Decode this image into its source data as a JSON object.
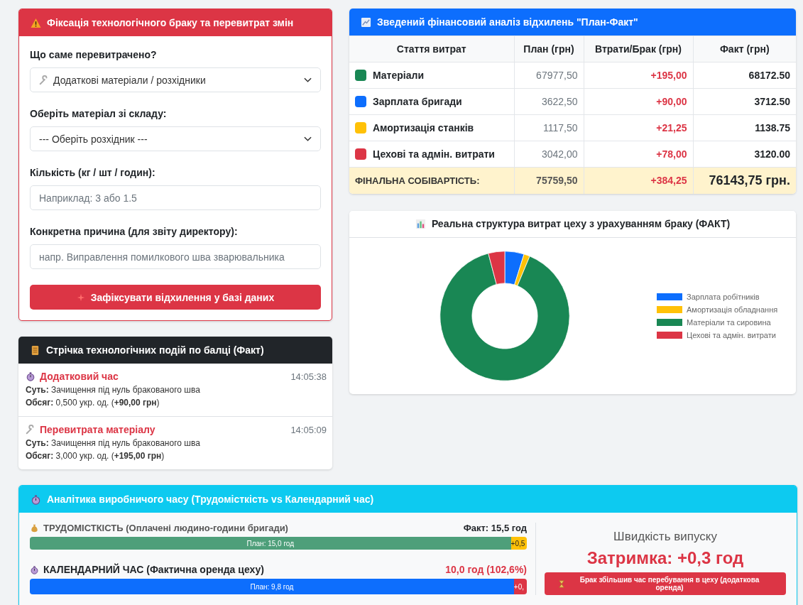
{
  "deviation_form": {
    "title": "Фіксація технологічного браку та перевитрат змін",
    "fields": [
      {
        "kind": "tool_select",
        "label": "Що саме перевитрачено?",
        "value": "Додаткові матеріали / розхідники"
      },
      {
        "kind": "select",
        "label": "Оберіть матеріал зі складу:",
        "value": "--- Оберіть розхідник ---"
      },
      {
        "kind": "input",
        "label": "Кількість (кг / шт / годин):",
        "placeholder": "Наприклад: 3 або 1.5"
      },
      {
        "kind": "input",
        "label": "Конкретна причина (для звіту директору):",
        "placeholder": "напр. Виправлення помилкового шва зварювальника"
      }
    ],
    "submit_button": "Зафіксувати відхилення у базі даних"
  },
  "event_feed": {
    "title": "Стрічка технологічних подій по балці (Факт)",
    "events": [
      {
        "kind": "time",
        "title": "Додатковий час",
        "time": "14:05:38",
        "essence": "**Суть:** Зачищення під нуль бракованого шва",
        "volume": "**Обсяг:** 0,500 укр. од. (**+90,00 грн**)"
      },
      {
        "kind": "material",
        "title": "Перевитрата матеріалу",
        "time": "14:05:09",
        "essence": "**Суть:** Зачищення під нуль бракованого шва",
        "volume": "**Обсяг:** 3,000 укр. од. (**+195,00 грн**)"
      }
    ]
  },
  "cost_analysis": {
    "title": "Зведений фінансовий аналіз відхилень \"План-Факт\"",
    "columns": [
      "Стаття витрат",
      "План (грн)",
      "Втрати/Брак (грн)",
      "Факт (грн)"
    ],
    "rows": [
      {
        "item": "Матеріали",
        "color": "#198754",
        "plan": "67977,50",
        "loss": "+195,00",
        "fact": "68172.50"
      },
      {
        "item": "Зарплата бригади",
        "color": "#0d6efd",
        "plan": "3622,50",
        "loss": "+90,00",
        "fact": "3712.50"
      },
      {
        "item": "Амортизація станків",
        "color": "#ffc107",
        "plan": "1117,50",
        "loss": "+21,25",
        "fact": "1138.75"
      },
      {
        "item": "Цехові та адмін. витрати",
        "color": "#dc3545",
        "plan": "3042,00",
        "loss": "+78,00",
        "fact": "3120.00"
      }
    ],
    "total": {
      "label": "ФІНАЛЬНА СОБІВАРТІСТЬ:",
      "plan": "75759,50",
      "loss": "+384,25",
      "fact": "76143,75 грн."
    }
  },
  "cost_structure": {
    "title": "Реальна структура витрат цеху з урахуванням браку (ФАКТ)",
    "legend": [
      {
        "label": "Зарплата робітників",
        "color": "#0d6efd"
      },
      {
        "label": "Амортизація обладнання",
        "color": "#ffc107"
      },
      {
        "label": "Матеріали та сировина",
        "color": "#198754"
      },
      {
        "label": "Цехові та адмін. витрати",
        "color": "#dc3545"
      }
    ]
  },
  "time_analytics": {
    "title": "Аналітика виробничого часу (Трудомісткість vs Календарний час)",
    "metrics": [
      {
        "kind": "labor",
        "label": "ТРУДОМІСТКІСТЬ (Оплачені людино-години бригади)",
        "reading": "Факт: 15,5 год",
        "plan_label": "План: 15,0 год",
        "level": 0.968,
        "extra": "+0,5"
      },
      {
        "kind": "calendar",
        "label": "КАЛЕНДАРНИЙ ЧАС (Фактична оренда цеху)",
        "reading": "10,0 год (102,6%)",
        "plan_label": "План: 9,8 год",
        "level": 0.974,
        "extra": "+0,"
      }
    ],
    "speed_title": "Швидкість випуску",
    "delay": "Затримка: +0,3 год",
    "alert": "Брак збільшив час перебування в цеху (додаткова оренда)"
  }
}
